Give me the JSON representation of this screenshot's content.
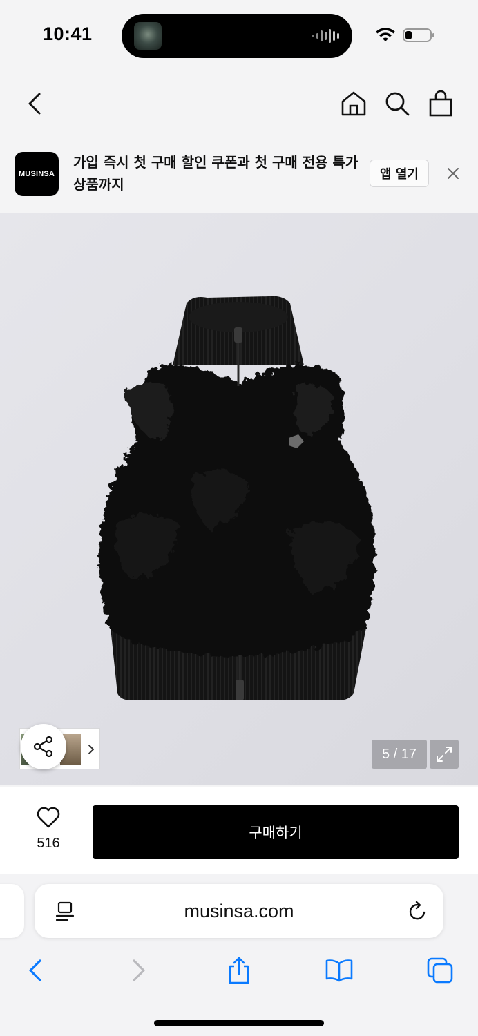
{
  "status_bar": {
    "time": "10:41"
  },
  "nav": {
    "back_icon": "chevron-left-icon",
    "home_icon": "home-icon",
    "search_icon": "search-icon",
    "bag_icon": "shopping-bag-icon"
  },
  "banner": {
    "logo": "MUSINSA",
    "text": "가입 즉시 첫 구매 할인 쿠폰과 첫 구매 전용 특가 상품까지",
    "open_label": "앱 열기",
    "close_icon": "close-icon"
  },
  "gallery": {
    "counter": "5 / 17",
    "share_icon": "share-icon",
    "expand_icon": "expand-icon",
    "thumbnail_chevron": "chevron-right-icon"
  },
  "buy_bar": {
    "like_icon": "heart-icon",
    "like_count": "516",
    "buy_label": "구매하기"
  },
  "browser": {
    "url": "musinsa.com",
    "reader_icon": "reader-icon",
    "reload_icon": "reload-icon",
    "toolbar": {
      "back_icon": "chevron-left-icon",
      "forward_icon": "chevron-right-icon",
      "share_icon": "share-icon",
      "bookmarks_icon": "book-icon",
      "tabs_icon": "tabs-icon"
    }
  },
  "colors": {
    "accent_blue": "#0a7aff",
    "buy_button": "#000000",
    "background": "#f4f4f5"
  }
}
